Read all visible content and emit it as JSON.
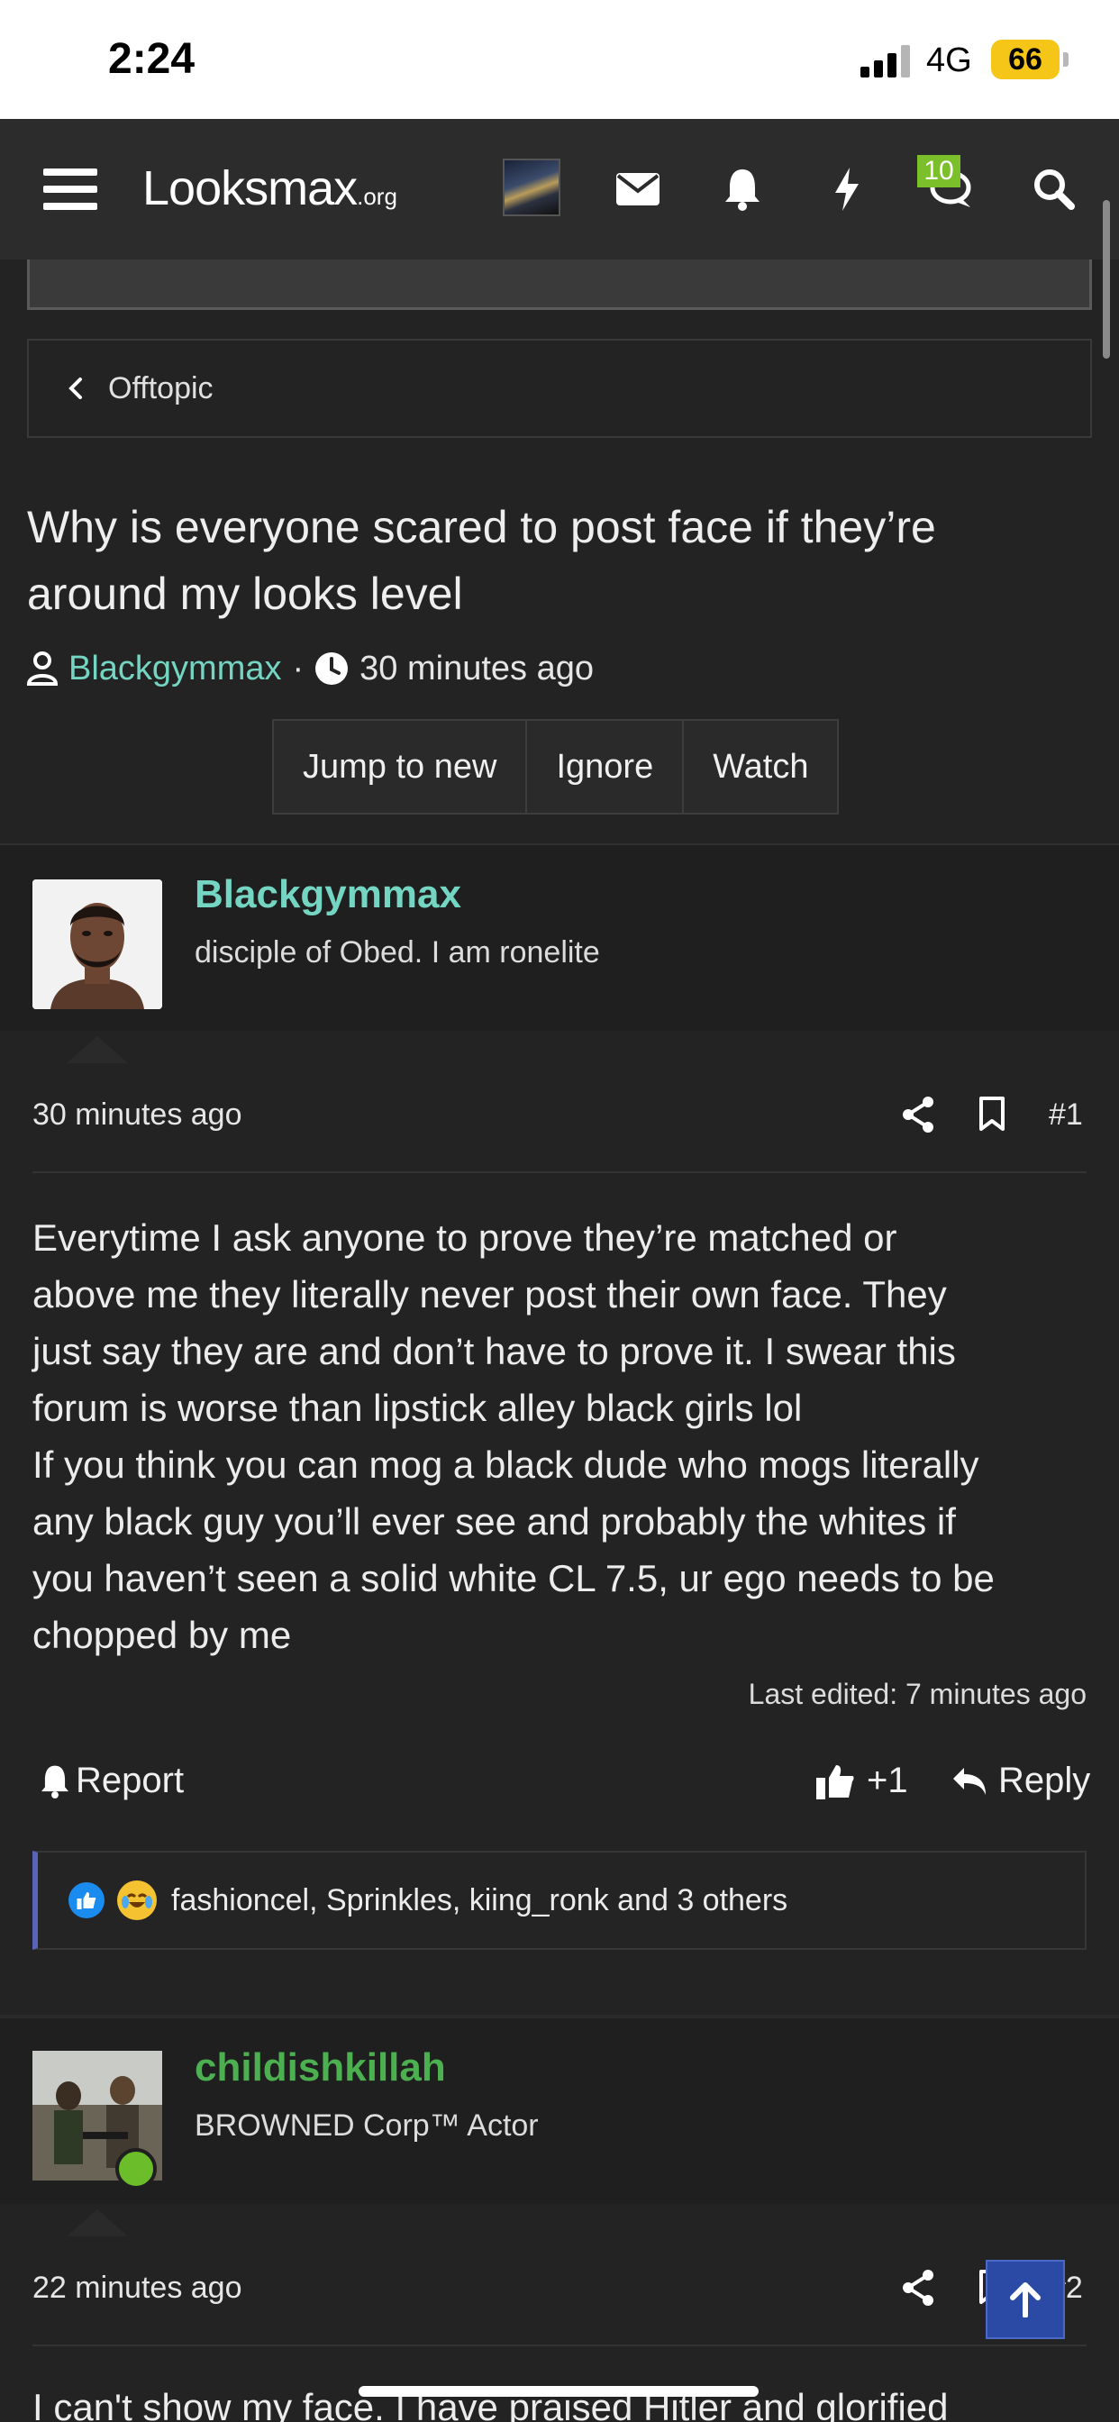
{
  "status_bar": {
    "time": "2:24",
    "network": "4G",
    "battery": "66"
  },
  "nav": {
    "logo_main": "Lᴏᴏksmax",
    "logo_suffix": ".org",
    "conversations_badge": "10",
    "icons": [
      "menu-icon",
      "envelope-icon",
      "bell-icon",
      "bolt-icon",
      "chat-icon",
      "search-icon"
    ]
  },
  "breadcrumb": {
    "label": "Offtopic"
  },
  "thread": {
    "title": "Why is everyone scared to post face if they’re around my looks level",
    "author": "Blackgymmax",
    "separator": "·",
    "time": "30 minutes ago",
    "buttons": [
      "Jump to new",
      "Ignore",
      "Watch"
    ]
  },
  "posts": [
    {
      "username": "Blackgymmax",
      "user_title": "disciple of Obed. I am ronelite",
      "date": "30 minutes ago",
      "number": "#1",
      "text_lines": [
        "Everytime I ask anyone to prove they’re matched or",
        "above me they literally never post their own face. They",
        "just say they are and don’t have to prove it. I swear this",
        "forum is worse than lipstick alley black girls lol",
        "If you think you can mog a black dude who mogs literally",
        "any black guy you’ll ever see and probably the whites if",
        "you haven’t seen a solid white CL 7.5, ur ego needs to be",
        "chopped by me"
      ],
      "last_edited": "Last edited: 7 minutes ago",
      "report_label": "Report",
      "like_count": "+1",
      "reply_label": "Reply",
      "reactions_text": "fashioncel, Sprinkles, kiing_ronk and 3 others"
    },
    {
      "username": "childishkillah",
      "user_title": "BROWNED Corp™ Actor",
      "date": "22 minutes ago",
      "number": "#2",
      "text_partial": "I can't show my face. I have praised Hitler and glorified"
    }
  ],
  "colors": {
    "background": "#232323",
    "navbar": "#2c2c2c",
    "username_op": "#74d6c2",
    "username_second": "#4caf50",
    "badge": "#7bbf2a",
    "reaction_bar": "#5964b8",
    "scroll_top": "#2b4aa6"
  }
}
